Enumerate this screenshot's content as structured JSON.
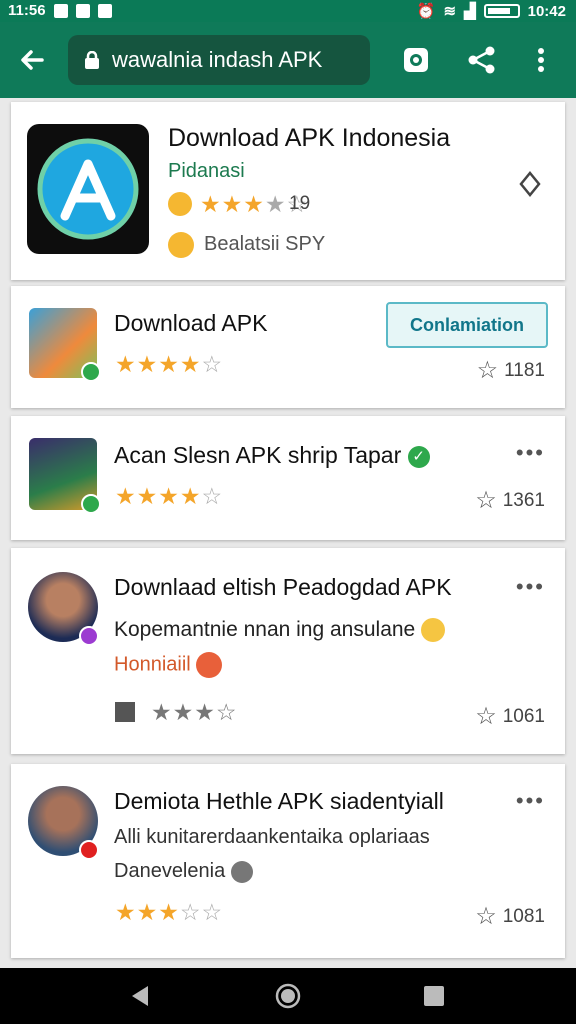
{
  "status_bar": {
    "left_time": "11:56",
    "right_time": "10:42"
  },
  "app_bar": {
    "url_text": "wawalnia indash APK"
  },
  "featured": {
    "title": "Download APK Indonesia",
    "developer": "Pidanasi",
    "rating": 3.5,
    "rating_count": "19",
    "tag": "Bealatsii SPY",
    "colors": {
      "developer": "#1c7a4f",
      "icon_blue": "#1e6fe0"
    }
  },
  "items": [
    {
      "title": "Download APK",
      "button": "Conlamiation",
      "rating": 4,
      "count": "1181"
    },
    {
      "title": "Acan Slesn APK shrip Tapar",
      "rating": 4.5,
      "count": "1361"
    },
    {
      "title": "Downlaad eltish Peadogdad APK",
      "line2": "Kopemantnie nnan ing ansulane",
      "line3": "Honniaiil",
      "rating": 3.5,
      "count": "1061"
    },
    {
      "title": "Demiota Hethle APK siadentyiall",
      "line2": "Alli kunitarerdaankentaika oplariaas",
      "line3": "Danevelenia",
      "rating": 3.5,
      "count": "1081"
    }
  ],
  "icons": [
    "back-arrow",
    "lock",
    "camera",
    "share",
    "more-vert",
    "pin",
    "nav-back",
    "nav-home",
    "nav-recents"
  ]
}
